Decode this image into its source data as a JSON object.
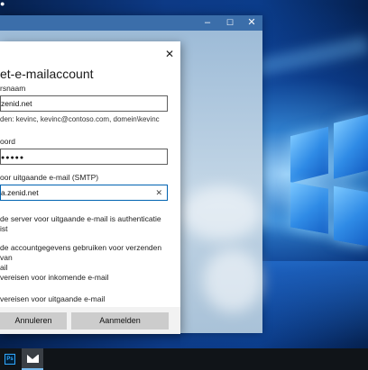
{
  "desktop": {
    "top_left_icon": "dot-icon"
  },
  "mail_window": {
    "controls": {
      "minimize": "–",
      "maximize": "☐",
      "close": "✕"
    }
  },
  "dialog": {
    "close_icon": "✕",
    "title": "et-e-mailaccount",
    "username": {
      "label": "rsnaam",
      "value": "zenid.net",
      "hint": "den: kevinc, kevinc@contoso.com, domein\\kevinc"
    },
    "password": {
      "label": "oord",
      "value": "●●●●●"
    },
    "smtp": {
      "label": "oor uitgaande e-mail (SMTP)",
      "value": "a.zenid.net",
      "clear_icon": "✕"
    },
    "options": [
      {
        "line1": "de server voor uitgaande e-mail is authenticatie",
        "line2": "ist"
      },
      {
        "line1": "de accountgegevens gebruiken voor verzenden van",
        "line2": "ail"
      },
      {
        "line1": "vereisen voor inkomende e-mail",
        "line2": ""
      },
      {
        "line1": "vereisen voor uitgaande e-mail",
        "line2": ""
      }
    ],
    "buttons": {
      "cancel": "Annuleren",
      "sign_in": "Aanmelden"
    }
  },
  "taskbar": {
    "items": [
      {
        "name": "photoshop",
        "label": "Ps"
      },
      {
        "name": "mail",
        "label": ""
      }
    ]
  }
}
